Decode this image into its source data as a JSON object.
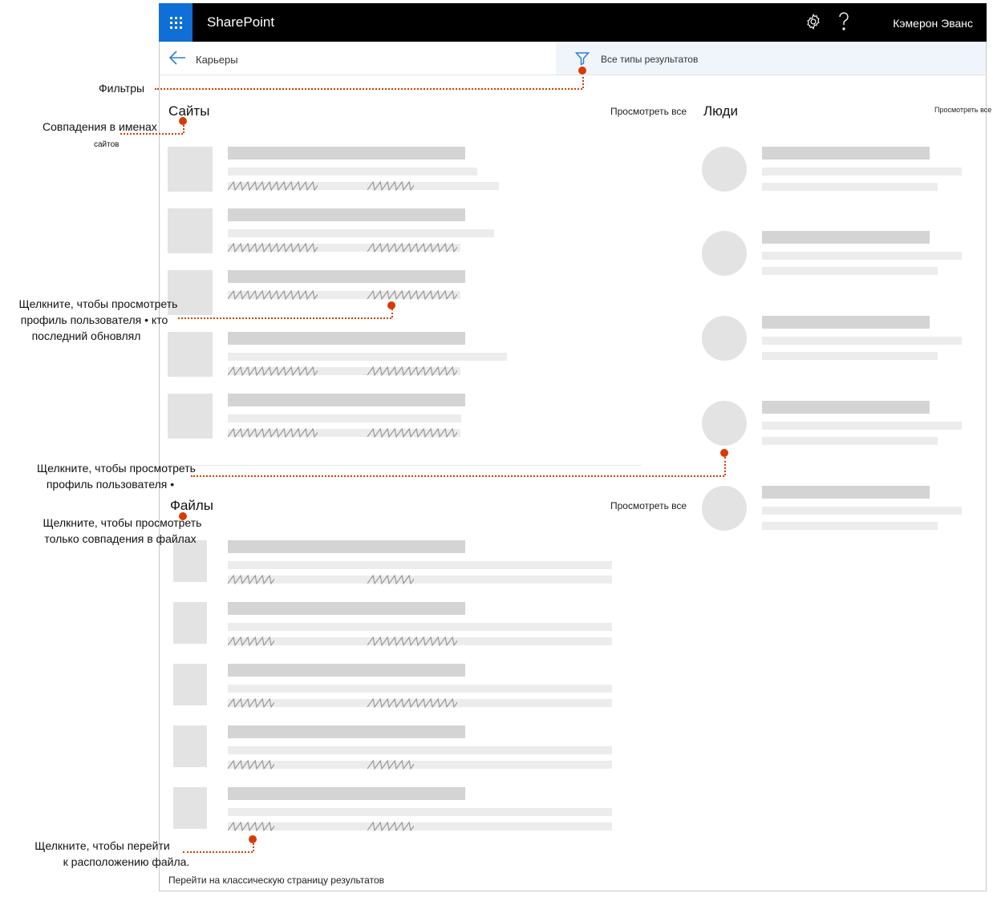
{
  "suitebar": {
    "app_name": "SharePoint",
    "user_name": "Кэмерон Эванс",
    "icons": [
      "waffle-icon",
      "gear-icon",
      "help-icon"
    ]
  },
  "commandbar": {
    "breadcrumb": "Карьеры",
    "filter_label": "Все типы результатов"
  },
  "sites": {
    "title": "Сайты",
    "view_all": "Просмотреть все"
  },
  "people": {
    "title": "Люди",
    "view_all": "Просмотреть все"
  },
  "files": {
    "title": "Файлы",
    "view_all": "Просмотреть все"
  },
  "footer": {
    "classic_link": "Перейти на классическую страницу результатов"
  },
  "annotations": {
    "filters": "Фильтры",
    "site_names_1": "Совпадения в именах",
    "site_names_2": "сайтов",
    "profile_updated_1": "Щелкните, чтобы просмотреть",
    "profile_updated_2": "профиль пользователя • кто",
    "profile_updated_3": "последний обновлял",
    "profile_1": "Щелкните, чтобы просмотреть",
    "profile_2": "профиль пользователя •",
    "files_only_1": "Щелкните, чтобы просмотреть",
    "files_only_2": "только совпадения в файлах",
    "file_location_1": "Щелкните, чтобы перейти",
    "file_location_2": "к расположению файла."
  },
  "colors": {
    "suitebar": "#000000",
    "waffle": "#0f6fd6",
    "annotation_dot": "#d83b01",
    "filter_bg": "#eff5fb"
  }
}
